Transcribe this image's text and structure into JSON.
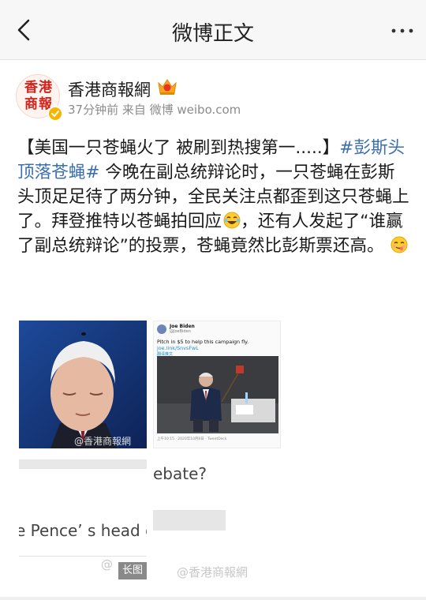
{
  "navbar": {
    "title": "微博正文",
    "back_icon": "chevron-left-icon",
    "more_icon": "more-dots-icon"
  },
  "author": {
    "avatar_text": "香港商報",
    "name": "香港商報網",
    "meta": "37分钟前  来自 微博 weibo.com",
    "verified_icon": "verified-badge-icon",
    "member_icon": "vip-member-icon"
  },
  "post": {
    "line1_text": "【美国一只苍蝇火了 被刷到热搜第一.....】",
    "topic": "#彭斯头顶落苍蝇#",
    "line2_text": " 今晚在副总统辩论时，一只苍蝇在彭斯头顶足足待了两分钟，全民关注点都歪到这只苍蝇上了。拜登推特以苍蝇拍回应",
    "line3_text": "，还有人发起了“谁赢了副总统辩论”的投票，苍蝇竟然比彭斯票还高。",
    "emoji1": "laughing-emoji-icon",
    "emoji2": "yum-emoji-icon"
  },
  "images": {
    "img1_watermark": "@香港商報網",
    "tweet_name": "Joe Biden",
    "tweet_handle": "@JoeBiden",
    "tweet_text": "Pitch in $5 to help this campaign fly.",
    "tweet_link": "joe.link/SnvsFwL",
    "tweet_translate": "翻译推文",
    "tweet_time": "上午10:15 · 2020年10月8日 · TweetDeck",
    "img4_text": "ebate?",
    "img3_text": "e Pence’ s head o",
    "watermark_left": "@",
    "watermark_right": "@香港商報網",
    "long_badge": "长图"
  },
  "colors": {
    "topic_blue": "#3b6fb0",
    "nav_bg": "#f7f7f7",
    "verify_gold": "#f7b500"
  }
}
